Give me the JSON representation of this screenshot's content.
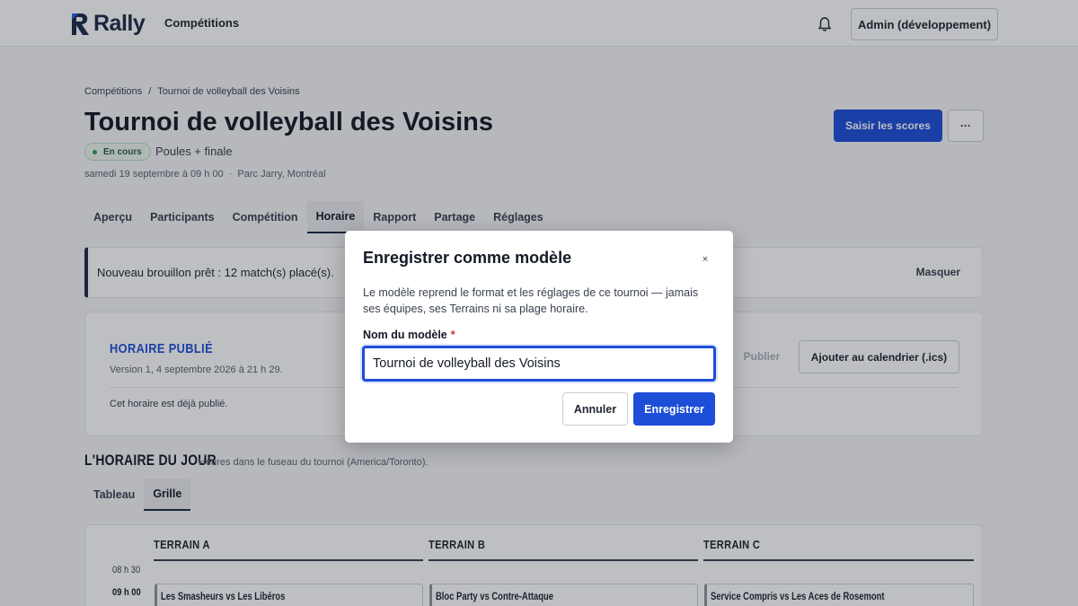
{
  "app": {
    "brand": "Rally",
    "brand_color": "#1b2b48",
    "accent_color": "#1d4ed8"
  },
  "topbar": {
    "nav_label": "Compétitions",
    "admin_label": "Admin (développement)",
    "bell_icon": "bell-icon"
  },
  "breadcrumb": {
    "root": "Compétitions",
    "separator": "/",
    "current": "Tournoi de volleyball des Voisins"
  },
  "header": {
    "title": "Tournoi de volleyball des Voisins",
    "status": "En cours",
    "format": "Poules + finale",
    "date": "samedi 19 septembre à 09 h 00",
    "meta_separator": "·",
    "venue": "Parc Jarry, Montréal",
    "scores_button": "Saisir les scores",
    "more_button": "···"
  },
  "tabs": [
    "Aperçu",
    "Participants",
    "Compétition",
    "Horaire",
    "Rapport",
    "Partage",
    "Réglages"
  ],
  "active_tab": "Horaire",
  "notice": {
    "text": "Nouveau brouillon prêt : 12 match(s) placé(s).",
    "dismiss": "Masquer"
  },
  "published": {
    "title": "HORAIRE PUBLIÉ",
    "version": "Version 1, 4 septembre 2026 à 21 h 29.",
    "note": "Cet horaire est déjà publié.",
    "publish_button": "Publier",
    "calendar_button": "Ajouter au calendrier (.ics)"
  },
  "day_schedule": {
    "title": "L'HORAIRE DU JOUR",
    "subtitle": "Heures dans le fuseau du tournoi (America/Toronto).",
    "views": [
      "Tableau",
      "Grille"
    ],
    "active_view": "Grille",
    "courts": [
      "TERRAIN A",
      "TERRAIN B",
      "TERRAIN C"
    ],
    "times": [
      "08 h 30",
      "09 h 00"
    ],
    "matches": [
      "Les Smasheurs vs Les Libéros",
      "Bloc Party vs Contre-Attaque",
      "Service Compris vs Les Aces de Rosemont"
    ]
  },
  "modal": {
    "title": "Enregistrer comme modèle",
    "close": "×",
    "description": "Le modèle reprend le format et les réglages de ce tournoi — jamais ses équipes, ses Terrains ni sa plage horaire.",
    "field_label": "Nom du modèle",
    "required_mark": "*",
    "field_value": "Tournoi de volleyball des Voisins",
    "cancel": "Annuler",
    "save": "Enregistrer"
  }
}
